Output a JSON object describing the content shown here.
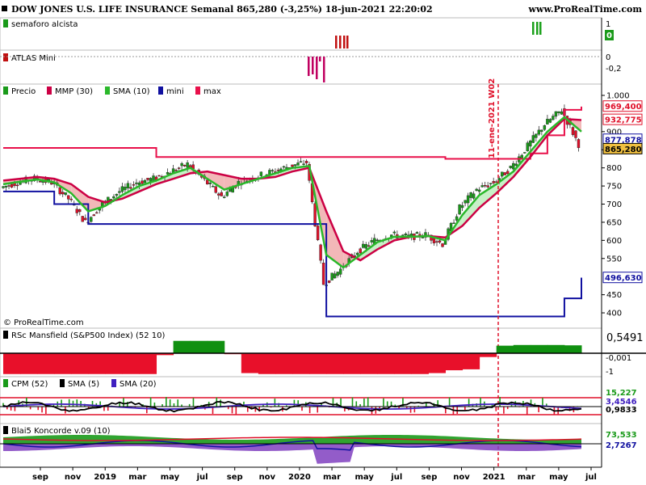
{
  "header": {
    "title": "DOW JONES U.S. LIFE INSURANCE Semanal 865,280 (-3,25%) 18-jun-2021 22:20:02",
    "site": "www.ProRealTime.com",
    "watermark": "© ProRealTime.com"
  },
  "annotation": {
    "text": "11-ene-2021 W02"
  },
  "colors": {
    "up": "#1a9a1a",
    "down": "#e0102a",
    "mmp": "#cc0044",
    "sma": "#2ab82a",
    "mini": "#1010a0",
    "max": "#e8104a",
    "cloud_red": "#f2b8b8",
    "cloud_green": "#c8f0c8",
    "rsc_pos": "#109010",
    "rsc_neg": "#e8102a"
  },
  "panes": {
    "semaforo": {
      "label": "semaforo alcista",
      "ticks": [
        "1",
        "0"
      ]
    },
    "atlas": {
      "label": "ATLAS Mini",
      "ticks": [
        "0",
        "-0,2"
      ]
    },
    "price": {
      "legend": [
        "Precio",
        "MMP (30)",
        "SMA (10)",
        "mini",
        "max"
      ],
      "ticks": [
        "1.000",
        "900",
        "850",
        "800",
        "750",
        "700",
        "650",
        "600",
        "550",
        "450",
        "400"
      ],
      "badges": [
        {
          "text": "969,400",
          "color": "#e0102a"
        },
        {
          "text": "932,775",
          "color": "#e0102a"
        },
        {
          "text": "877,878",
          "color": "#1010a0"
        },
        {
          "text": "865,280",
          "color": "#000000"
        },
        {
          "text": "496,630",
          "color": "#1010a0"
        }
      ]
    },
    "rsc": {
      "label": "RSc Mansfield (S&P500 Index) (52 10)",
      "value": "0,5491",
      "ticks": [
        "-0,001",
        "-1"
      ]
    },
    "cpm": {
      "label": "CPM (52)",
      "legend": [
        "SMA (5)",
        "SMA (20)"
      ],
      "badges": [
        "15,227",
        "3,4546",
        "0,9833"
      ]
    },
    "koncorde": {
      "label": "Blai5 Koncorde v.09 (10)",
      "badges": [
        "73,533",
        "2,7267"
      ]
    }
  },
  "x_axis": {
    "ticks": [
      "sep",
      "nov",
      "2019",
      "mar",
      "may",
      "jul",
      "sep",
      "nov",
      "2020",
      "mar",
      "may",
      "jul",
      "sep",
      "nov",
      "2021",
      "mar",
      "may",
      "jul"
    ]
  },
  "chart_data": {
    "type": "line",
    "title": "DOW JONES U.S. LIFE INSURANCE Semanal",
    "x": [
      "2018-08",
      "2018-09",
      "2018-10",
      "2018-11",
      "2018-12",
      "2019-01",
      "2019-02",
      "2019-03",
      "2019-04",
      "2019-05",
      "2019-06",
      "2019-07",
      "2019-08",
      "2019-09",
      "2019-10",
      "2019-11",
      "2019-12",
      "2020-01",
      "2020-02",
      "2020-03",
      "2020-04",
      "2020-05",
      "2020-06",
      "2020-07",
      "2020-08",
      "2020-09",
      "2020-10",
      "2020-11",
      "2020-12",
      "2021-01",
      "2021-02",
      "2021-03",
      "2021-04",
      "2021-05",
      "2021-06"
    ],
    "series": [
      {
        "name": "Precio",
        "values": [
          745,
          760,
          770,
          760,
          715,
          650,
          700,
          735,
          760,
          770,
          790,
          810,
          765,
          720,
          760,
          775,
          790,
          805,
          815,
          480,
          520,
          570,
          600,
          615,
          610,
          615,
          590,
          690,
          740,
          760,
          800,
          860,
          920,
          960,
          865
        ]
      },
      {
        "name": "MMP (30)",
        "values": [
          765,
          770,
          775,
          770,
          755,
          720,
          705,
          715,
          735,
          755,
          770,
          785,
          790,
          780,
          770,
          770,
          775,
          790,
          800,
          680,
          570,
          545,
          575,
          600,
          610,
          612,
          608,
          640,
          690,
          730,
          775,
          830,
          890,
          935,
          932
        ]
      },
      {
        "name": "SMA (10)",
        "values": [
          755,
          762,
          768,
          760,
          730,
          680,
          695,
          725,
          750,
          765,
          785,
          800,
          770,
          740,
          755,
          770,
          785,
          800,
          805,
          560,
          525,
          560,
          595,
          610,
          610,
          612,
          600,
          670,
          725,
          755,
          790,
          845,
          900,
          940,
          900
        ]
      },
      {
        "name": "mini",
        "values": [
          735,
          735,
          735,
          700,
          700,
          645,
          645,
          645,
          645,
          645,
          645,
          645,
          645,
          645,
          645,
          645,
          645,
          645,
          645,
          390,
          390,
          390,
          390,
          390,
          390,
          390,
          390,
          390,
          390,
          390,
          390,
          390,
          390,
          440,
          497
        ]
      },
      {
        "name": "max",
        "values": [
          855,
          855,
          855,
          855,
          855,
          855,
          855,
          855,
          855,
          830,
          830,
          830,
          830,
          830,
          830,
          830,
          830,
          830,
          830,
          830,
          830,
          830,
          830,
          830,
          830,
          830,
          825,
          825,
          825,
          825,
          825,
          840,
          890,
          960,
          969
        ]
      }
    ],
    "ylim": [
      380,
      1000
    ],
    "rsc": [
      -1.1,
      -1.1,
      -1.1,
      -1.1,
      -1.1,
      -1.1,
      -1.1,
      -1.1,
      -1.1,
      -1.1,
      0.9,
      0.9,
      0.9,
      0.9,
      -1.0,
      -1.1,
      -1.1,
      -1.1,
      -1.1,
      -1.1,
      -1.1,
      -1.1,
      -1.1,
      -1.1,
      -1.1,
      -1.1,
      -1.0,
      -0.8,
      -0.9,
      0.5,
      0.6,
      0.6,
      0.6,
      0.6,
      0.55
    ]
  }
}
